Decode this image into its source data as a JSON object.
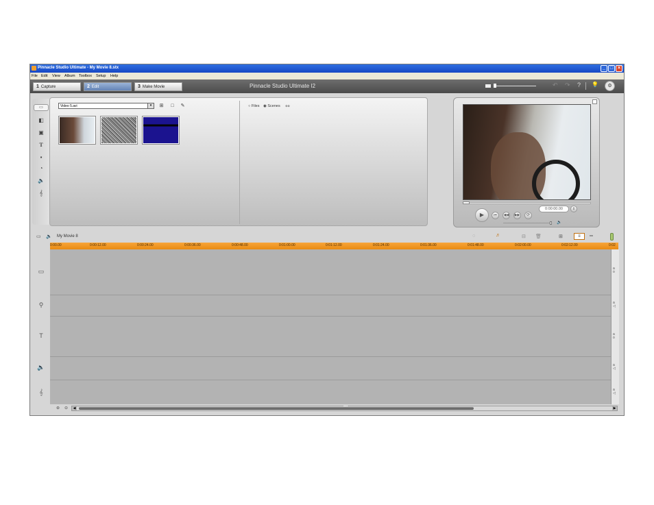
{
  "window": {
    "title": "Pinnacle Studio Ultimate - My Movie 8.stx",
    "minimize": "_",
    "maximize": "□",
    "close": "×"
  },
  "menu": [
    "File",
    "Edit",
    "View",
    "Album",
    "Toolbox",
    "Setup",
    "Help"
  ],
  "tabs": [
    {
      "num": "1",
      "label": "Capture"
    },
    {
      "num": "2",
      "label": "Edit"
    },
    {
      "num": "3",
      "label": "Make Movie"
    }
  ],
  "app_name": "Pinnacle Studio Ultimate I2",
  "album": {
    "source": "Video 5.avi",
    "view_options": {
      "files": "Files",
      "scenes": "Scenes",
      "selected": "Scenes"
    },
    "thumbnails": [
      "clip-driver",
      "clip-noise",
      "clip-blue"
    ]
  },
  "player": {
    "timecode": "0:00:00.00"
  },
  "timeline": {
    "project_name": "My Movie 8",
    "ruler_labels": [
      "0:00.00",
      "0:00:12.00",
      "0:00:24.00",
      "0:00:36.00",
      "0:00:48.00",
      "0:01:00.00",
      "0:01:12.00",
      "0:01:24.00",
      "0:01:36.00",
      "0:01:48.00",
      "0:02:00.00",
      "0:02:12.00",
      "0:02"
    ],
    "scroll_dots": "•••"
  },
  "colors": {
    "accent": "#1747c4",
    "ruler": "#f09a20",
    "close": "#d9452c"
  }
}
